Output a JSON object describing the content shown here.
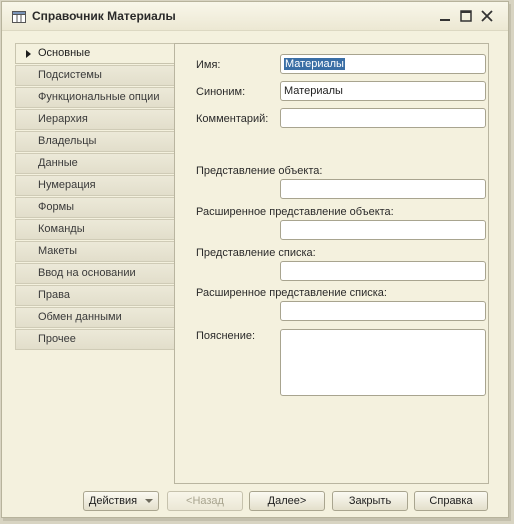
{
  "window": {
    "title": "Справочник Материалы"
  },
  "tabs": [
    {
      "label": "Основные",
      "active": true
    },
    {
      "label": "Подсистемы"
    },
    {
      "label": "Функциональные опции"
    },
    {
      "label": "Иерархия"
    },
    {
      "label": "Владельцы"
    },
    {
      "label": "Данные"
    },
    {
      "label": "Нумерация"
    },
    {
      "label": "Формы"
    },
    {
      "label": "Команды"
    },
    {
      "label": "Макеты"
    },
    {
      "label": "Ввод на основании"
    },
    {
      "label": "Права"
    },
    {
      "label": "Обмен данными"
    },
    {
      "label": "Прочее"
    }
  ],
  "form": {
    "name_label": "Имя:",
    "name_value": "Материалы",
    "synonym_label": "Синоним:",
    "synonym_value": "Материалы",
    "comment_label": "Комментарий:",
    "comment_value": "",
    "object_repr_label": "Представление объекта:",
    "object_repr_value": "",
    "ext_object_repr_label": "Расширенное представление объекта:",
    "ext_object_repr_value": "",
    "list_repr_label": "Представление списка:",
    "list_repr_value": "",
    "ext_list_repr_label": "Расширенное представление списка:",
    "ext_list_repr_value": "",
    "explanation_label": "Пояснение:",
    "explanation_value": ""
  },
  "buttons": {
    "actions": "Действия",
    "back": "<Назад",
    "next": "Далее>",
    "close": "Закрыть",
    "help": "Справка"
  },
  "colors": {
    "selection": "#3a6ea5",
    "background": "#f4f1de"
  }
}
